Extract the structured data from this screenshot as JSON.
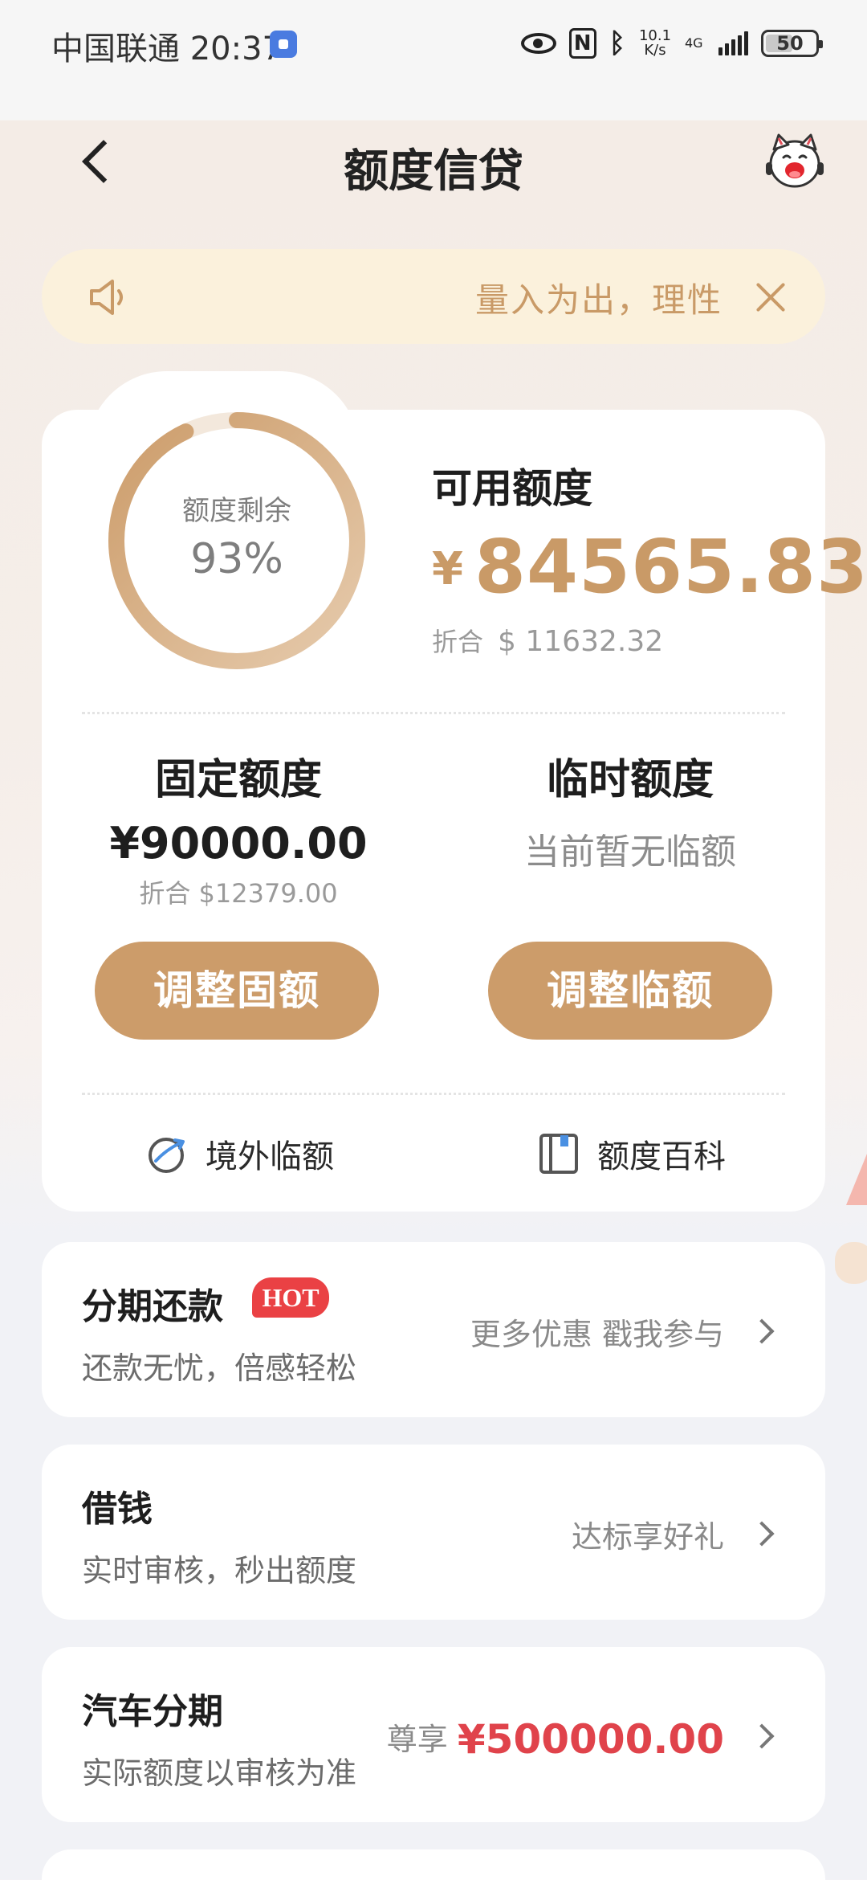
{
  "status_bar": {
    "carrier": "中国联通",
    "time": "20:37",
    "net_speed_value": "10.1",
    "net_speed_unit": "K/s",
    "network": "4G",
    "battery": "50"
  },
  "header": {
    "title": "额度信贷"
  },
  "notice": {
    "text": "量入为出，理性"
  },
  "credit": {
    "ring_label": "额度剩余",
    "ring_percent": "93%",
    "ring_fraction": 0.93,
    "available_title": "可用额度",
    "available_currency": "¥",
    "available_amount": "84565.83",
    "available_usd_label": "折合",
    "available_usd": "$ 11632.32",
    "fixed_title": "固定额度",
    "fixed_amount": "¥90000.00",
    "fixed_usd": "折合 $12379.00",
    "temp_title": "临时额度",
    "temp_none": "当前暂无临额",
    "adjust_fixed_button": "调整固额",
    "adjust_temp_button": "调整临额",
    "overseas_link": "境外临额",
    "encyclopedia_link": "额度百科"
  },
  "services": {
    "installment": {
      "title": "分期还款",
      "badge": "HOT",
      "subtitle": "还款无忧，倍感轻松",
      "right": "更多优惠 戳我参与"
    },
    "borrow": {
      "title": "借钱",
      "subtitle": "实时审核，秒出额度",
      "right": "达标享好礼"
    },
    "car": {
      "title": "汽车分期",
      "subtitle": "实际额度以审核为准",
      "right_prefix": "尊享",
      "right_amount": "¥500000.00"
    }
  },
  "colors": {
    "accent": "#cc9c6a",
    "accent_text": "#c99a67",
    "hot_red": "#ea4144",
    "amount_red": "#e0434b"
  }
}
